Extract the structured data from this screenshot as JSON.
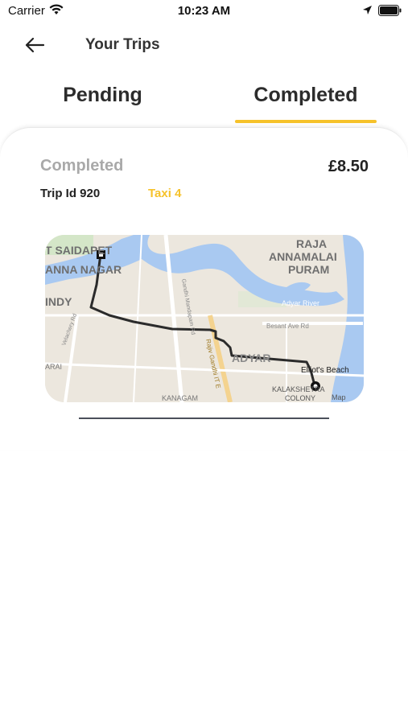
{
  "status_bar": {
    "carrier": "Carrier",
    "time": "10:23 AM"
  },
  "header": {
    "title": "Your Trips",
    "back_icon": "back-arrow-icon"
  },
  "tabs": [
    {
      "label": "Pending",
      "active": false
    },
    {
      "label": "Completed",
      "active": true
    }
  ],
  "accent_color": "#f6c22b",
  "trip": {
    "status": "Completed",
    "fare": "£8.50",
    "trip_id": "Trip Id 920",
    "taxi": "Taxi 4",
    "map_labels": {
      "raja": "RAJA",
      "annamalai": "ANNAMALAI",
      "puram": "PURAM",
      "saidapet": "T SAIDAPET",
      "anna_nagar": "ANNA NAGAR",
      "indy": "INDY",
      "adyar": "ADYAR",
      "adyar_river": "Adyar River",
      "besant": "Besant Ave Rd",
      "elliots": "Elliot's Beach",
      "kalakshetra": "KALAKSHETRA",
      "colony": "COLONY",
      "kanagam": "KANAGAM",
      "arai": "ARAI",
      "gandhi_mandapam": "Gandhi Mandapam Rd",
      "rajiv_gandhi": "Rajiv Gandhi IT E",
      "velachery": "Velachery Rd",
      "map_credit": "Map"
    }
  }
}
